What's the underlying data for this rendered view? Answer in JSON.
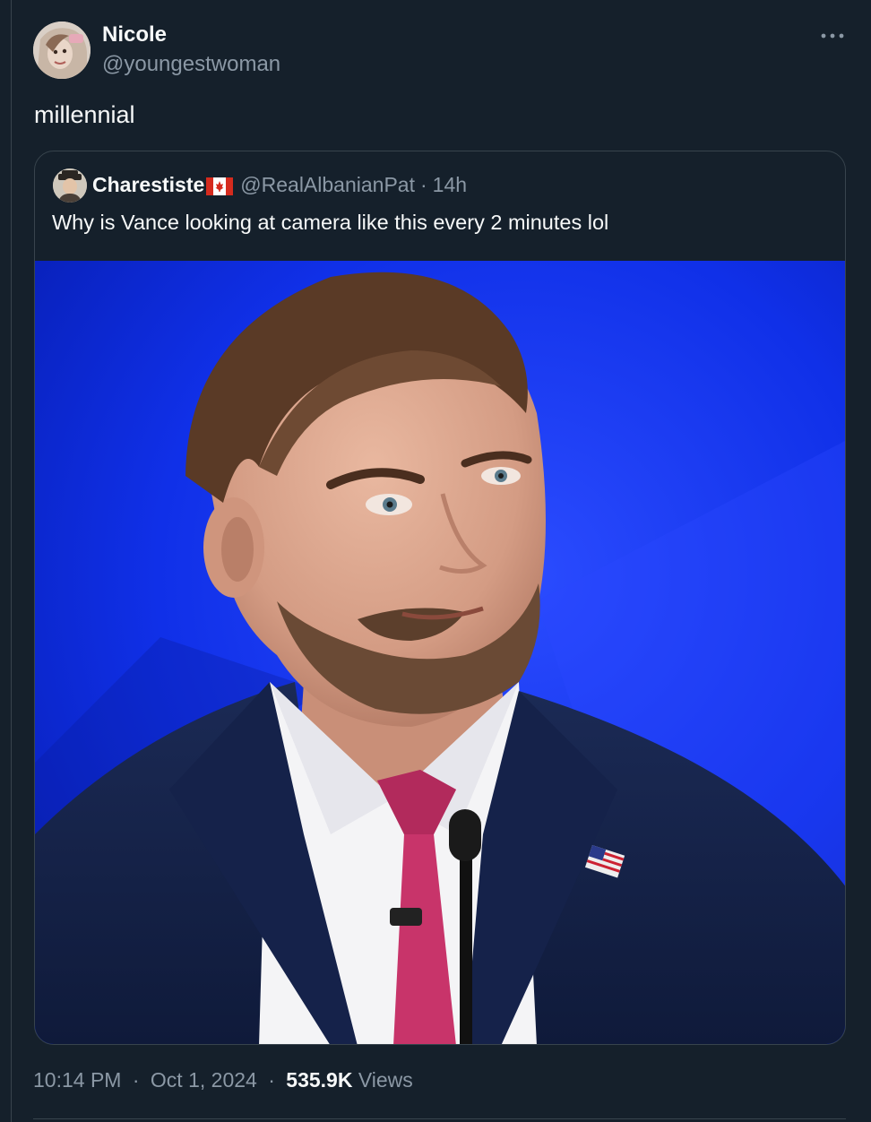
{
  "tweet": {
    "author": {
      "name": "Nicole",
      "handle": "@youngestwoman",
      "avatar_icon": "user-avatar-icon"
    },
    "more_icon": "more-dots-icon",
    "text": "millennial",
    "quoted": {
      "author": {
        "name": "Charestiste",
        "flag_icon": "canada-flag-icon",
        "handle": "@RealAlbanianPat",
        "separator": "·",
        "time": "14h"
      },
      "text": "Why is Vance looking at camera like this every 2 minutes lol",
      "media_icon": "photo-icon"
    },
    "meta": {
      "time": "10:14 PM",
      "date": "Oct 1, 2024",
      "separator": "·",
      "views_count": "535.9K",
      "views_label": "Views"
    }
  },
  "colors": {
    "background": "#15202b",
    "text_primary": "#f7f9f9",
    "text_secondary": "#8b98a5",
    "border": "#38444d",
    "photo_backdrop": "#0b2ad6"
  }
}
